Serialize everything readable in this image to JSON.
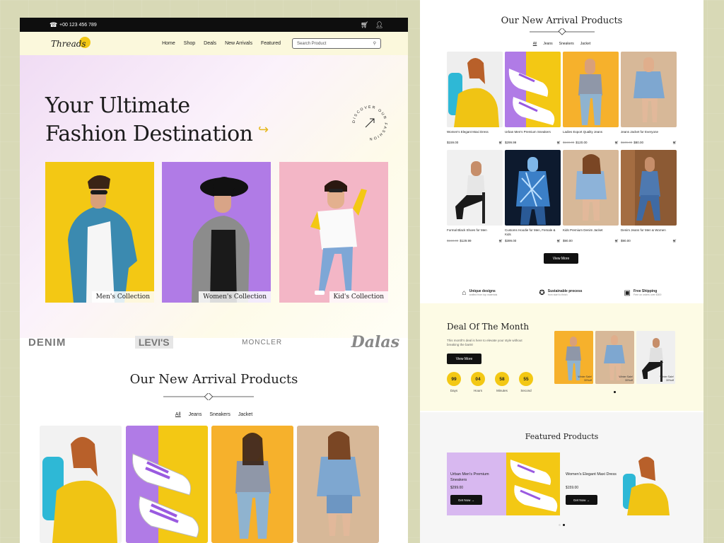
{
  "topbar": {
    "phone": "+00 123 456 789",
    "phone_icon": "phone-icon",
    "cart_icon": "cart-icon",
    "user_icon": "user-icon"
  },
  "nav": {
    "logo": "Threads",
    "menu": [
      "Home",
      "Shop",
      "Deals",
      "New Arrivals",
      "Featured"
    ],
    "search_placeholder": "Search Product"
  },
  "hero": {
    "title_line1": "Your Ultimate",
    "title_line2": "Fashion Destination",
    "badge_text": "DISCOVER OUR FASHION",
    "collections": [
      "Men's Collection",
      "Women's Collection",
      "Kid's Collection"
    ]
  },
  "brands": [
    "DENIM",
    "LEVI'S",
    "MONCLER",
    "Dalas"
  ],
  "arrivals": {
    "title": "Our New Arrival Products",
    "filters": [
      "All",
      "Jeans",
      "Sneakers",
      "Jacket"
    ],
    "products": [
      {
        "name": "Women's Elegant Maxi Dress",
        "price": "$159.00",
        "old": ""
      },
      {
        "name": "Urban Men's Premium Sneakers",
        "price": "$299.99",
        "old": ""
      },
      {
        "name": "Ladies Export Quality Jeans",
        "price": "$120.00",
        "old": "$160.00"
      },
      {
        "name": "Jeans Jacket for Everyone",
        "price": "$80.00",
        "old": "$109.00"
      },
      {
        "name": "Formal Black Shoes for Men",
        "price": "$129.99",
        "old": "$160.00"
      },
      {
        "name": "Customs Hoodie for Men, Female & Kids",
        "price": "$399.00",
        "old": ""
      },
      {
        "name": "Kids Premium Denim Jacket",
        "price": "$90.00",
        "old": ""
      },
      {
        "name": "Denim Jeans for Men & Women",
        "price": "$90.00",
        "old": ""
      }
    ],
    "view_more": "View More"
  },
  "features": [
    {
      "title": "Unique designs",
      "sub": "crafted from top materials",
      "icon": "tag-icon"
    },
    {
      "title": "Sustainable process",
      "sub": "from start to finish",
      "icon": "award-icon"
    },
    {
      "title": "Free Shipping",
      "sub": "Free on orders over $300",
      "icon": "box-icon"
    }
  ],
  "deal": {
    "title": "Deal Of The Month",
    "text": "This month's deal is here to elevate your style without breaking the bank!",
    "button": "View More",
    "countdown": [
      {
        "value": "99",
        "unit": "Days"
      },
      {
        "value": "04",
        "unit": "Hours"
      },
      {
        "value": "58",
        "unit": "Minutes"
      },
      {
        "value": "55",
        "unit": "Second"
      }
    ],
    "products": [
      {
        "line1": "Winter Sale!",
        "line2": "30%off"
      },
      {
        "line1": "Winter Sale!",
        "line2": "30%off"
      },
      {
        "line1": "Winter Sale!",
        "line2": "30%off"
      }
    ]
  },
  "featured": {
    "title": "Featured Products",
    "products": [
      {
        "name": "Urban Men's Premium Sneakers",
        "price": "$299.00",
        "button": "Get Now"
      },
      {
        "name": "Women's Elegant Maxi Dress",
        "price": "$159.00",
        "button": "Get Now"
      }
    ]
  },
  "colors": {
    "accent_yellow": "#f3c814",
    "accent_purple": "#b07be6",
    "accent_pink": "#f3b6c6",
    "dark": "#111111"
  }
}
